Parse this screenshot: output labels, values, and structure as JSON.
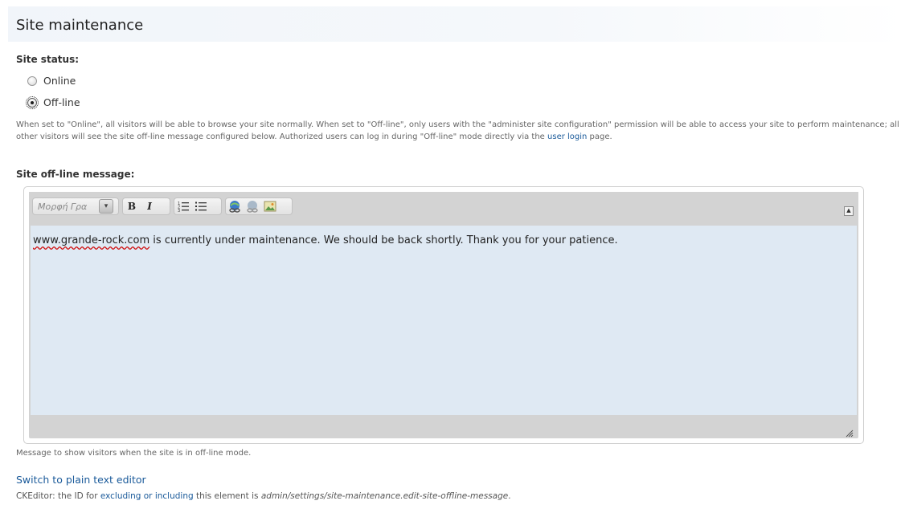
{
  "page": {
    "title": "Site maintenance"
  },
  "site_status": {
    "label": "Site status:",
    "options": [
      {
        "label": "Online",
        "checked": false
      },
      {
        "label": "Off-line",
        "checked": true
      }
    ],
    "description": {
      "before_link": "When set to \"Online\", all visitors will be able to browse your site normally. When set to \"Off-line\", only users with the \"administer site configuration\" permission will be able to access your site to perform maintenance; all other visitors will see the site off-line message configured below. Authorized users can log in during \"Off-line\" mode directly via the ",
      "link_text": "user login",
      "after_link": " page."
    }
  },
  "offline_message": {
    "label": "Site off-line message:",
    "editor": {
      "format_placeholder": "Μορφή Γρα",
      "toolbar_icons": [
        "bold",
        "italic",
        "numbered-list-icon",
        "bulleted-list-icon",
        "link-icon",
        "unlink-icon",
        "image-icon"
      ],
      "bold_glyph": "B",
      "italic_glyph": "I",
      "content_spellerror": "www.grande-rock.com",
      "content_rest": " is currently under maintenance. We should be back shortly. Thank you for your patience."
    },
    "help": "Message to show visitors when the site is in off-line mode."
  },
  "footer": {
    "switch_link": "Switch to plain text editor",
    "cke_prefix": "CKEditor: the ID for ",
    "cke_link": "excluding or including",
    "cke_middle": " this element is ",
    "cke_id": "admin/settings/site-maintenance.edit-site-offline-message",
    "cke_suffix": "."
  }
}
